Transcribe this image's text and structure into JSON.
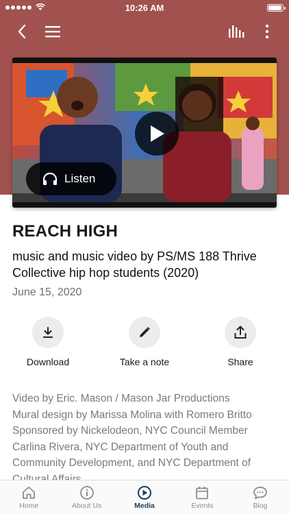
{
  "status_bar": {
    "time": "10:26 AM"
  },
  "header": {
    "back_icon": "chevron-left-icon",
    "menu_icon": "hamburger-menu-icon",
    "audio_icon": "audio-bars-icon",
    "more_icon": "more-vertical-icon",
    "background_color": "#a1524e"
  },
  "video": {
    "play_icon": "play-icon",
    "listen_label": "Listen",
    "listen_icon": "headphones-icon"
  },
  "episode": {
    "title": "REACH HIGH",
    "subtitle": "music and music video by PS/MS 188 Thrive Collective hip hop students (2020)",
    "date": "June 15, 2020"
  },
  "actions": {
    "download_label": "Download",
    "note_label": "Take a note",
    "share_label": "Share"
  },
  "description": {
    "line1": "Video by Eric. Mason / Mason Jar Productions",
    "line2": "Mural design by Marissa Molina with Romero Britto",
    "line3": "Sponsored by Nickelodeon, NYC Council Member Carlina Rivera, NYC Department of Youth and Community Development, and NYC Department of Cultural Affairs"
  },
  "tabs": [
    {
      "label": "Home",
      "icon": "home-icon"
    },
    {
      "label": "About Us",
      "icon": "info-icon"
    },
    {
      "label": "Media",
      "icon": "play-circle-icon",
      "active": true
    },
    {
      "label": "Events",
      "icon": "calendar-icon"
    },
    {
      "label": "Blog",
      "icon": "chat-bubble-icon"
    }
  ],
  "colors": {
    "accent": "#1d3b5a",
    "header": "#a1524e"
  }
}
